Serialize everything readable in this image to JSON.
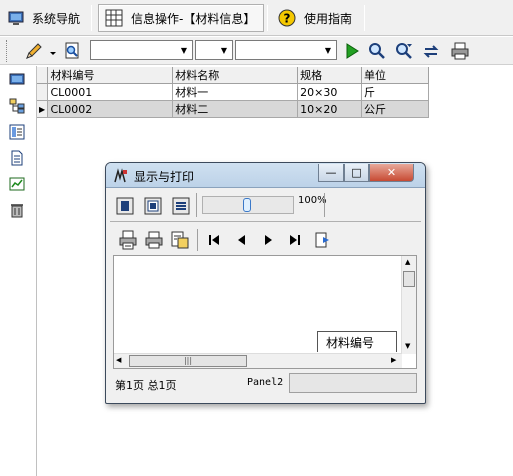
{
  "tabs": [
    {
      "label": "系统导航",
      "icon": "monitor-icon"
    },
    {
      "label": "信息操作-【材料信息】",
      "icon": "grid-icon"
    },
    {
      "label": "使用指南",
      "icon": "help-icon"
    }
  ],
  "toolbar": {
    "combo1_value": "",
    "combo2_value": "",
    "combo3_value": "",
    "icons": [
      "pencil-icon",
      "dropdown-arrow-icon",
      "preview-icon",
      "run-icon",
      "find-icon",
      "find-next-icon",
      "replace-icon",
      "print-icon"
    ]
  },
  "grid": {
    "columns": [
      "材料编号",
      "材料名称",
      "规格",
      "单位"
    ],
    "rows": [
      [
        "CL0001",
        "材料一",
        "20×30",
        "斤"
      ],
      [
        "CL0002",
        "材料二",
        "10×20",
        "公斤"
      ]
    ],
    "selected_row": 2
  },
  "dialog": {
    "title": "显示与打印",
    "zoom_label": "100%",
    "slider_level": 0.5,
    "column_header_label": "材料编号",
    "status_page": "第1页 总1页",
    "status_panel": "Panel2",
    "title_buttons": [
      "minimize-icon",
      "maximize-icon",
      "close-icon"
    ]
  }
}
